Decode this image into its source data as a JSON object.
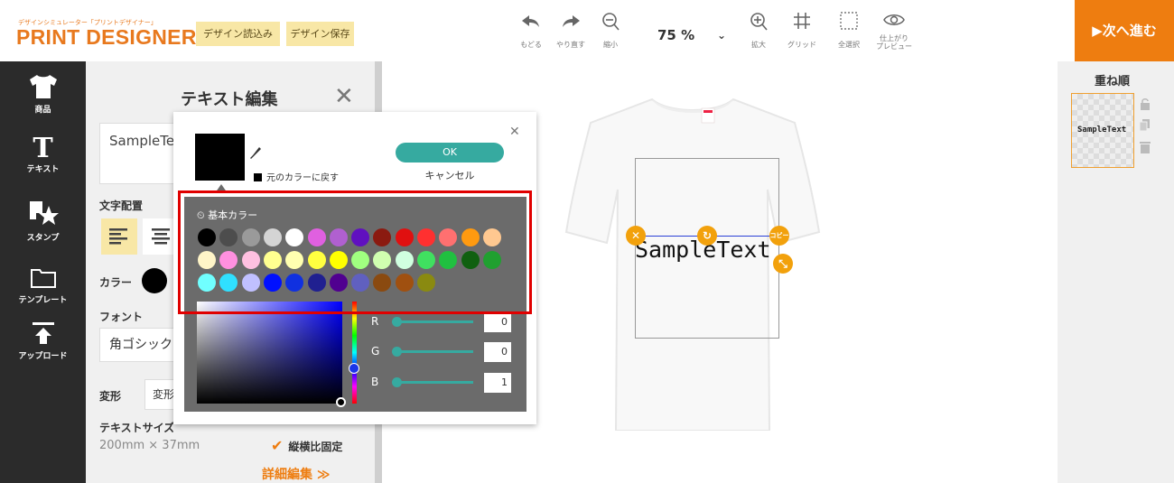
{
  "header": {
    "logo_tagline": "デザインシミュレーター「プリントデザイナー」",
    "logo_title": "PRINT DESIGNER",
    "load_label": "デザイン読込み",
    "save_label": "デザイン保存",
    "tools": [
      {
        "label": "もどる",
        "icon": "undo-icon"
      },
      {
        "label": "やり直す",
        "icon": "redo-icon"
      },
      {
        "label": "縮小",
        "icon": "zoom-out-icon"
      },
      {
        "label": "拡大",
        "icon": "zoom-in-icon"
      },
      {
        "label": "グリッド",
        "icon": "grid-icon"
      },
      {
        "label": "全選択",
        "icon": "select-all-icon"
      },
      {
        "label": "仕上がり\nプレビュー",
        "icon": "eye-icon"
      }
    ],
    "zoom_value": "75 %",
    "next_label": "▶次へ進む"
  },
  "left_nav": [
    {
      "label": "商品",
      "icon": "tshirt-icon"
    },
    {
      "label": "テキスト",
      "icon": "text-icon"
    },
    {
      "label": "スタンプ",
      "icon": "stamp-icon"
    },
    {
      "label": "テンプレート",
      "icon": "folder-icon"
    },
    {
      "label": "アップロード",
      "icon": "upload-icon"
    }
  ],
  "edit_panel": {
    "title": "テキスト編集",
    "text_value": "SampleTe",
    "align_label": "文字配置",
    "color_label": "カラー",
    "font_label": "フォント",
    "font_value": "角ゴシック",
    "transform_label": "変形",
    "transform_value": "変形",
    "size_label": "テキストサイズ",
    "size_value": "200mm × 37mm",
    "aspect_label": "縦横比固定",
    "detail_label": "詳細編集 ≫"
  },
  "color_picker": {
    "ok_label": "OK",
    "cancel_label": "キャンセル",
    "reset_label": "元のカラーに戻す",
    "basic_title": "基本カラー",
    "current_color": "#000000",
    "swatches": [
      [
        "#000000",
        "#4d4d4d",
        "#9a9a9a",
        "#d4d4d4",
        "#ffffff",
        "#e060e0",
        "#b060d0",
        "#6010c0",
        "#8b1a10",
        "#e01010",
        "#ff3030",
        "#ff7070",
        "#ff9a10",
        "#ffc890"
      ],
      [
        "#fff5c8",
        "#ff90e0",
        "#ffc0e0",
        "#ffff90",
        "#ffffb0",
        "#ffff40",
        "#ffff00",
        "#a0ff80",
        "#d0ffb0",
        "#d0ffe0",
        "#40e060",
        "#20c040",
        "#106010",
        "#20a030"
      ],
      [
        "#70ffff",
        "#30e0ff",
        "#c0c0ff",
        "#0010ff",
        "#1030e0",
        "#202090",
        "#500090",
        "#6060c0",
        "#8a4a10",
        "#a05010",
        "#8a8a10"
      ]
    ],
    "rgb": [
      {
        "label": "R",
        "value": "0"
      },
      {
        "label": "G",
        "value": "0"
      },
      {
        "label": "B",
        "value": "1"
      }
    ]
  },
  "canvas": {
    "sample_text": "SampleText",
    "copy_handle": "コピー"
  },
  "right_panel": {
    "title": "重ね順",
    "layer_text": "SampleText"
  },
  "colors": {
    "accent_orange": "#ee7d10",
    "button_yellow": "#f8e7a6",
    "teal": "#36aaa0",
    "highlight_red": "#e00000",
    "sidebar_dark": "#2b2b2b"
  }
}
